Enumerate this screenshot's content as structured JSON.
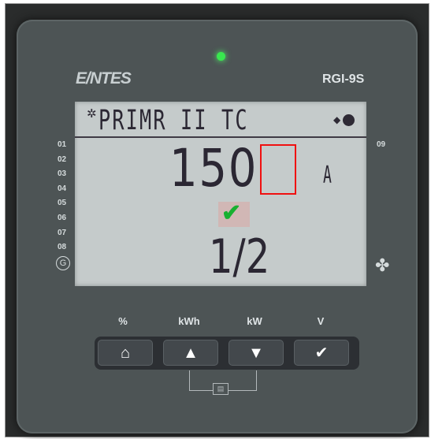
{
  "brand": "E/NTES",
  "model": "RGI-9S",
  "lcd": {
    "heading": "PRIMR II TC",
    "main_value": "150",
    "unit": "A",
    "sub_value": "1/2"
  },
  "indicators_left": [
    "01",
    "02",
    "03",
    "04",
    "05",
    "06",
    "07",
    "08"
  ],
  "indicator_right": "09",
  "function_labels": [
    "%",
    "kWh",
    "kW",
    "V"
  ],
  "buttons": [
    {
      "icon": "home-icon"
    },
    {
      "icon": "arrow-up-icon"
    },
    {
      "icon": "arrow-down-icon"
    },
    {
      "icon": "check-icon"
    }
  ],
  "colors": {
    "led": "#39e84f",
    "lcd_bg": "#c5cbcb",
    "highlight": "#f01010",
    "check": "#18b030"
  }
}
